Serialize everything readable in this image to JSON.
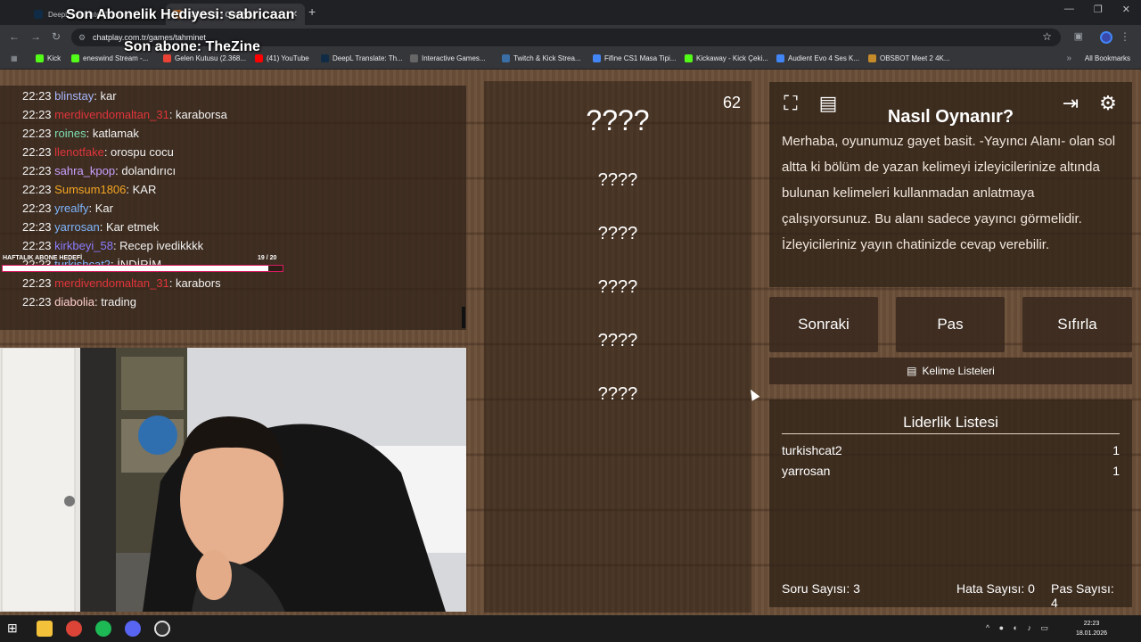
{
  "browser": {
    "tabs": [
      {
        "label": "DeepL Translate: The world's m",
        "active": false
      },
      {
        "label": "Tahmin Et - ChatPlay",
        "active": true
      }
    ],
    "url": "chatplay.com.tr/games/tahminet",
    "bookmarks": [
      "Kick",
      "eneswind Stream -...",
      "Gelen Kutusu (2.368...",
      "(41) YouTube",
      "DeepL Translate: Th...",
      "Interactive Games...",
      "Twitch & Kick Strea...",
      "Fifine CS1 Masa Tipi...",
      "Kickaway - Kick Çeki...",
      "Audient Evo 4 Ses K...",
      "OBSBOT Meet 2 4K..."
    ],
    "all_bookmarks": "All Bookmarks"
  },
  "overlay": {
    "sub_gift": "Son Abonelik Hediyesi: sabricaan",
    "last_sub": "Son abone: TheZine",
    "goal_label": "HAFTALIK ABONE HEDEFİ",
    "goal_count": "19  / 20",
    "goal_fraction": 0.95
  },
  "chat": [
    {
      "time": "22:23",
      "user": "blinstay",
      "color": "#a9b8ff",
      "text": ": kar"
    },
    {
      "time": "22:23",
      "user": "merdivendomaltan_31",
      "color": "#e0353b",
      "text": ": karaborsa"
    },
    {
      "time": "22:23",
      "user": "roines",
      "color": "#7ee0b0",
      "text": ": katlamak"
    },
    {
      "time": "22:23",
      "user": "llenotfake",
      "color": "#e0353b",
      "text": ": orospu cocu"
    },
    {
      "time": "22:23",
      "user": "sahra_kpop",
      "color": "#c9a0ff",
      "text": ": dolandırıcı"
    },
    {
      "time": "22:23",
      "user": "Sumsum1806",
      "color": "#f5a623",
      "text": ": KAR"
    },
    {
      "time": "22:23",
      "user": "yrealfy",
      "color": "#7fb6ff",
      "text": ": Kar"
    },
    {
      "time": "22:23",
      "user": "yarrosan",
      "color": "#7fb6ff",
      "text": ": Kar etmek"
    },
    {
      "time": "22:23",
      "user": "kirkbeyi_58",
      "color": "#8a7dff",
      "text": ": Recep ivedikkkk"
    },
    {
      "time": "22:23",
      "user": "turkishcat2",
      "color": "#7fb6ff",
      "text": ": İNDİRİM"
    },
    {
      "time": "22:23",
      "user": "merdivendomaltan_31",
      "color": "#e0353b",
      "text": ": karabors"
    },
    {
      "time": "22:23",
      "user": "diabolia",
      "color": "#ffd0d0",
      "text": ": trading"
    }
  ],
  "game": {
    "timer": "62",
    "main_word": "????",
    "hidden_words": [
      "????",
      "????",
      "????",
      "????",
      "????"
    ],
    "howto_title": "Nasıl Oynanır?",
    "howto_text": "Merhaba, oyunumuz gayet basit. -Yayıncı Alanı- olan sol altta ki bölüm de yazan kelimeyi izleyicilerinize altında bulunan kelimeleri kullanmadan anlatmaya çalışıyorsunuz. Bu alanı sadece yayıncı görmelidir. İzleyicileriniz yayın chatinizde cevap verebilir.",
    "buttons": {
      "next": "Sonraki",
      "pass": "Pas",
      "reset": "Sıfırla",
      "lists": "Kelime Listeleri"
    },
    "leaderboard_title": "Liderlik Listesi",
    "leaderboard": [
      {
        "name": "turkishcat2",
        "score": "1"
      },
      {
        "name": "yarrosan",
        "score": "1"
      }
    ],
    "stats": {
      "questions": "Soru Sayısı: 3",
      "errors": "Hata Sayısı: 0",
      "passes": "Pas Sayısı: 4"
    }
  },
  "taskbar": {
    "time": "22:23",
    "date": "18.01.2026"
  },
  "icons": [
    "fullscreen-icon",
    "document-icon",
    "exit-icon",
    "gear-icon",
    "list-icon"
  ]
}
